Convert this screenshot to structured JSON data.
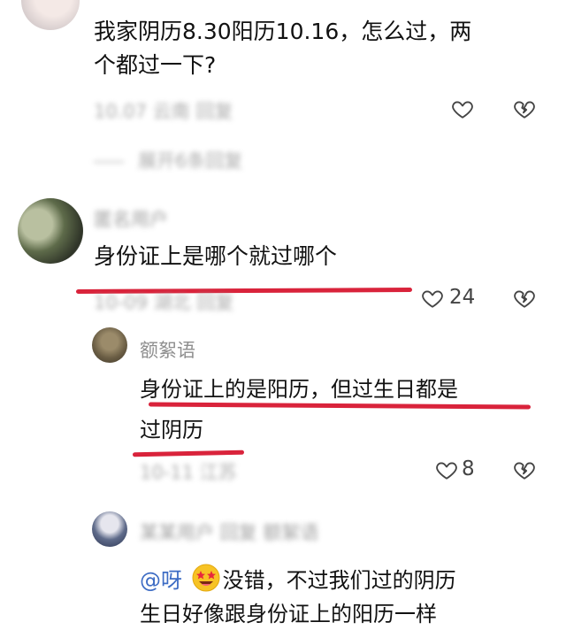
{
  "comments": [
    {
      "text_line1": "我家阴历8.30阳历10.16，怎么过，两",
      "text_line2": "个都过一下?",
      "meta": "10.07 云南 回复",
      "expand_label": "展开6条回复"
    },
    {
      "username": "匿名用户",
      "text": "身份证上是哪个就过哪个",
      "meta": "10-09 湖北 回复",
      "like_count": "24"
    }
  ],
  "replies": [
    {
      "username": "额絮语",
      "text_line1": "身份证上的是阳历，但过生日都是",
      "text_line2": "过阴历",
      "meta": "10-11 江苏",
      "like_count": "8"
    },
    {
      "username": "某某用户 回复 额絮语",
      "mention": "@呀",
      "text_line1_rest": "没错，不过我们过的阴历",
      "text_line2": "生日好像跟身份证上的阳历一样"
    }
  ],
  "colors": {
    "highlight_red": "#d9233b",
    "mention_blue": "#3d6cc4",
    "meta_gray": "#9a9a9a"
  },
  "icons": [
    "heart-outline-icon",
    "broken-heart-icon",
    "star-struck-emoji-icon"
  ]
}
